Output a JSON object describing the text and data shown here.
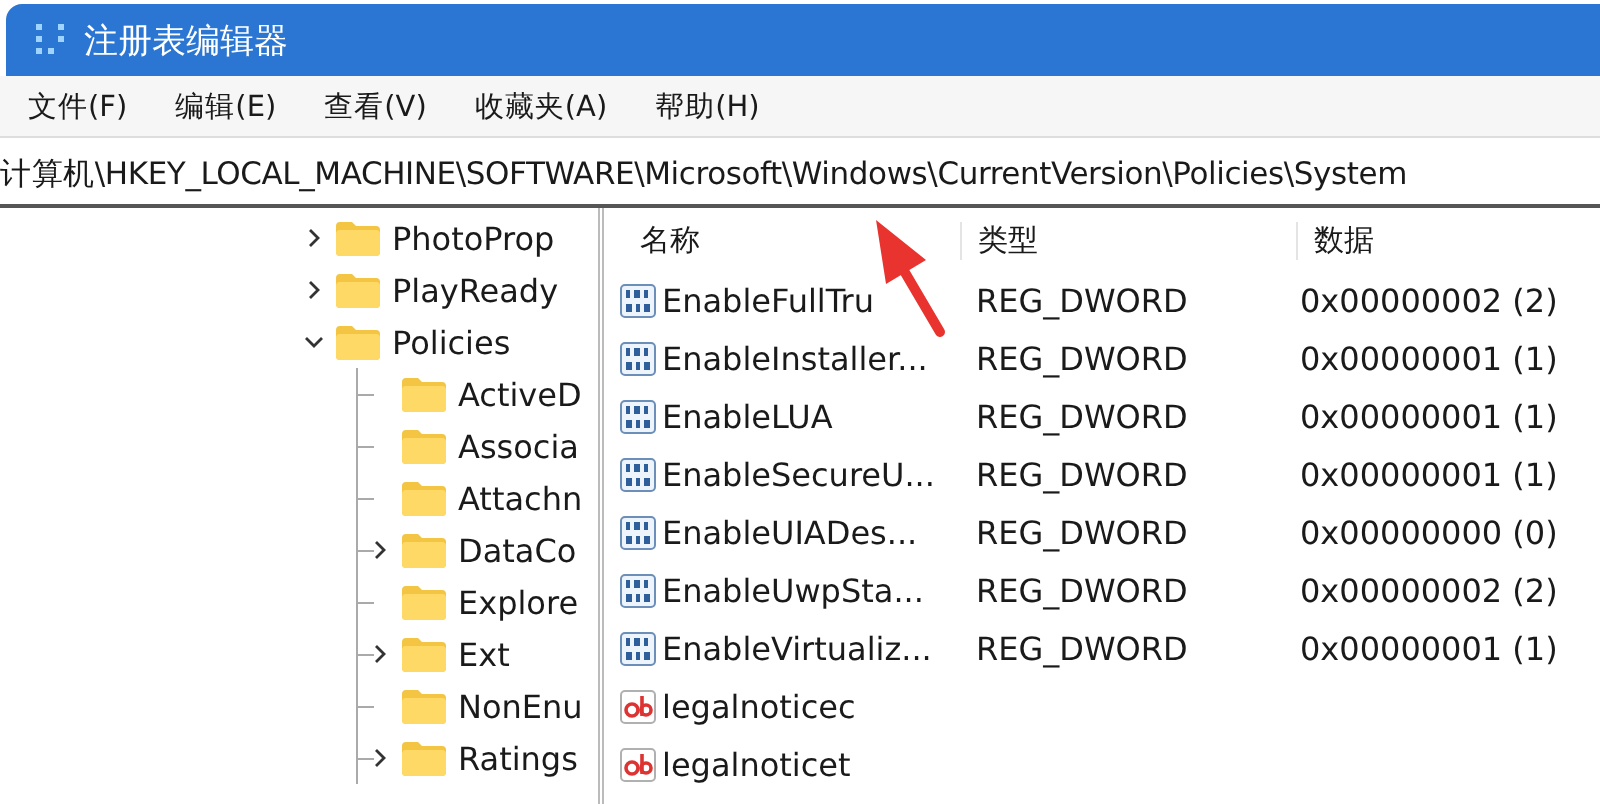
{
  "window": {
    "title": "注册表编辑器"
  },
  "menu": [
    "文件(F)",
    "编辑(E)",
    "查看(V)",
    "收藏夹(A)",
    "帮助(H)"
  ],
  "address": "计算机\\HKEY_LOCAL_MACHINE\\SOFTWARE\\Microsoft\\Windows\\CurrentVersion\\Policies\\System",
  "tree": [
    {
      "label": "PhotoProp",
      "expanded": false
    },
    {
      "label": "PlayReady",
      "expanded": false
    },
    {
      "label": "Policies",
      "expanded": true,
      "children": [
        {
          "label": "ActiveD"
        },
        {
          "label": "Associa"
        },
        {
          "label": "Attachn"
        },
        {
          "label": "DataCo",
          "expanded": false
        },
        {
          "label": "Explore"
        },
        {
          "label": "Ext",
          "expanded": false
        },
        {
          "label": "NonEnu"
        },
        {
          "label": "Ratings",
          "expanded": false
        }
      ]
    }
  ],
  "table": {
    "columns": [
      "名称",
      "类型",
      "数据"
    ],
    "rows": [
      {
        "kind": "dword",
        "name": "EnableFullTru",
        "type": "REG_DWORD",
        "data": "0x00000002 (2)"
      },
      {
        "kind": "dword",
        "name": "EnableInstaller...",
        "type": "REG_DWORD",
        "data": "0x00000001 (1)"
      },
      {
        "kind": "dword",
        "name": "EnableLUA",
        "type": "REG_DWORD",
        "data": "0x00000001 (1)"
      },
      {
        "kind": "dword",
        "name": "EnableSecureU...",
        "type": "REG_DWORD",
        "data": "0x00000001 (1)"
      },
      {
        "kind": "dword",
        "name": "EnableUIADes...",
        "type": "REG_DWORD",
        "data": "0x00000000 (0)"
      },
      {
        "kind": "dword",
        "name": "EnableUwpSta...",
        "type": "REG_DWORD",
        "data": "0x00000002 (2)"
      },
      {
        "kind": "dword",
        "name": "EnableVirtualiz...",
        "type": "REG_DWORD",
        "data": "0x00000001 (1)"
      },
      {
        "kind": "string",
        "name": "legalnoticec"
      },
      {
        "kind": "string",
        "name": "legalnoticet"
      }
    ]
  }
}
